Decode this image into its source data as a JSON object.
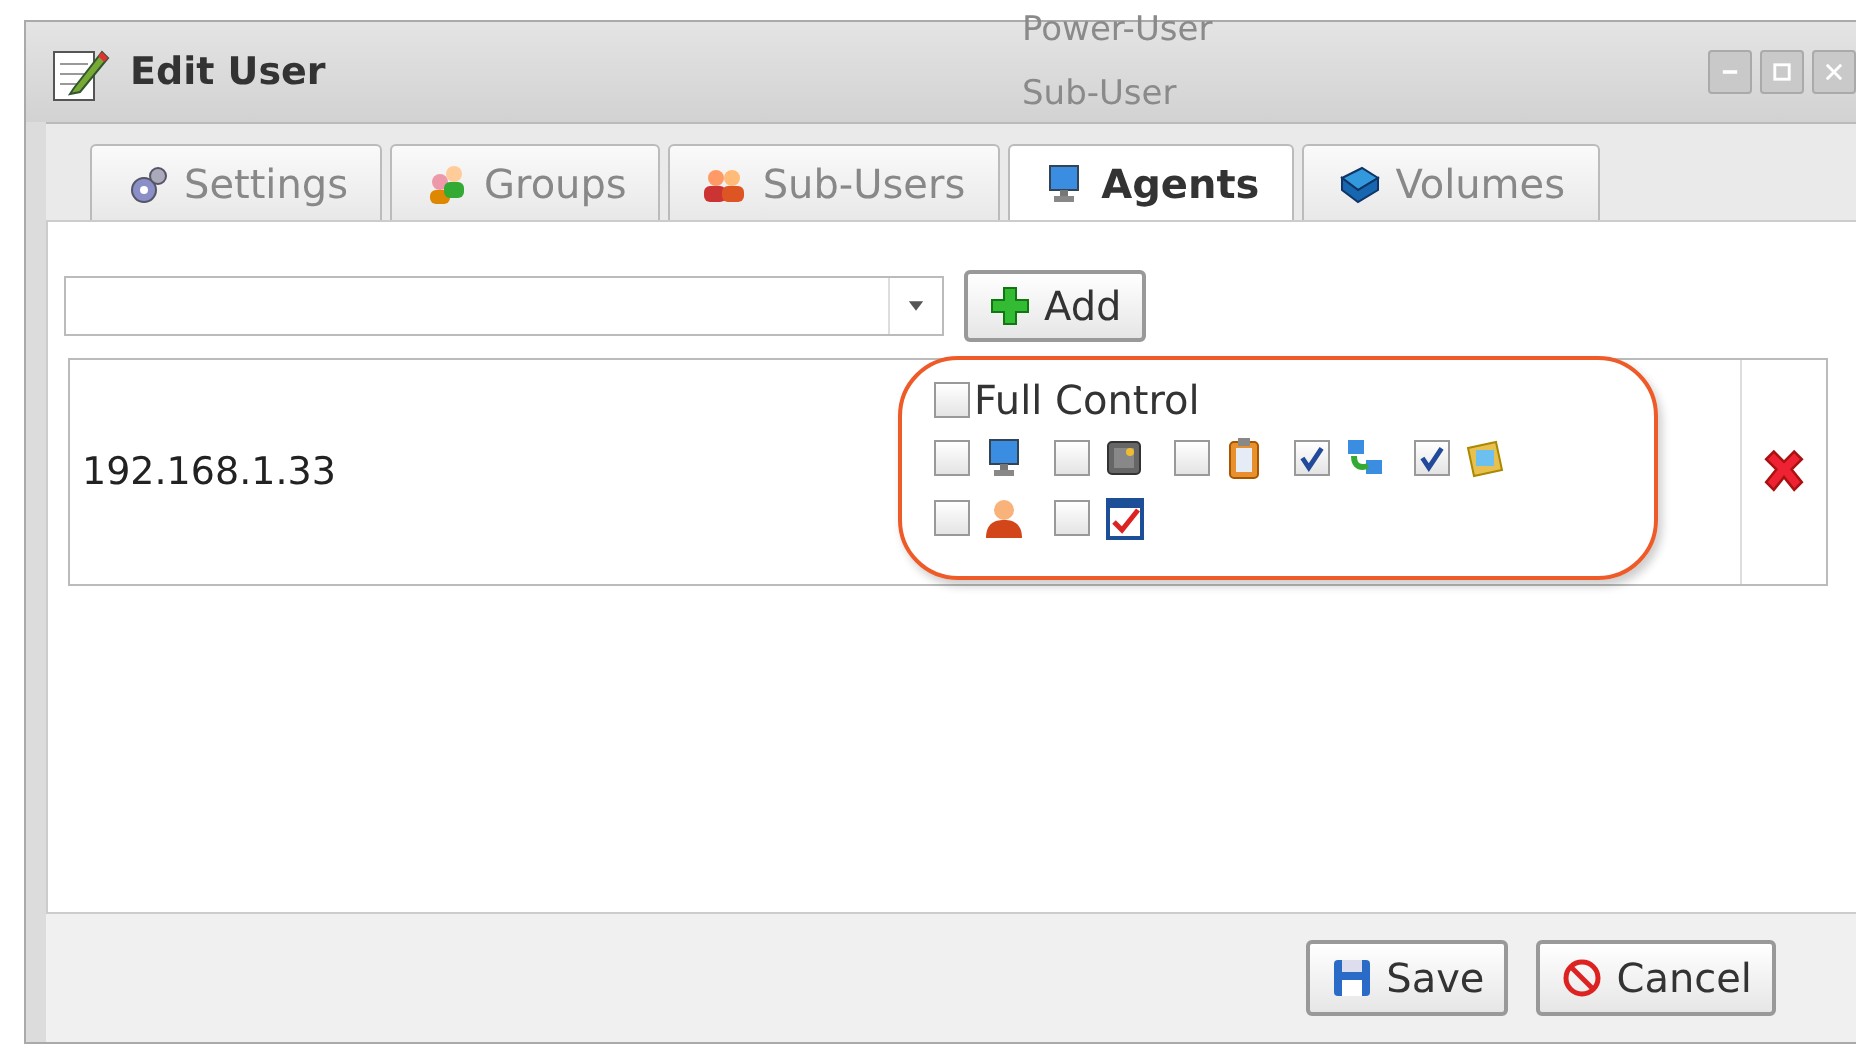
{
  "window": {
    "title": "Edit User"
  },
  "background_menu": [
    "Power-User",
    "Sub-User"
  ],
  "tabs": [
    {
      "label": "Settings",
      "selected": false
    },
    {
      "label": "Groups",
      "selected": false
    },
    {
      "label": "Sub-Users",
      "selected": false
    },
    {
      "label": "Agents",
      "selected": true
    },
    {
      "label": "Volumes",
      "selected": false
    }
  ],
  "add_button": "Add",
  "agents": [
    {
      "address": "192.168.1.33",
      "full_control": {
        "label": "Full Control",
        "checked": false
      },
      "permissions": [
        {
          "kind": "monitor",
          "checked": false
        },
        {
          "kind": "safe",
          "checked": false
        },
        {
          "kind": "clipboard",
          "checked": false
        },
        {
          "kind": "network",
          "checked": true
        },
        {
          "kind": "image",
          "checked": true
        },
        {
          "kind": "person",
          "checked": false
        },
        {
          "kind": "checklist",
          "checked": false
        }
      ]
    }
  ],
  "buttons": [
    {
      "label": "Save",
      "kind": "save"
    },
    {
      "label": "Cancel",
      "kind": "cancel"
    }
  ]
}
